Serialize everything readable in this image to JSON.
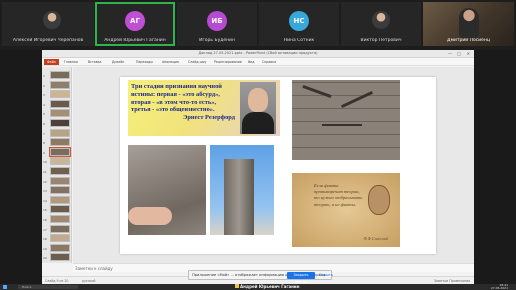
{
  "participants": [
    {
      "name": "Алексей Игоревич Черепанов",
      "initials": "",
      "color": "",
      "type": "photo"
    },
    {
      "name": "Андрей Юрьевич Гаганин",
      "initials": "АГ",
      "color": "#c14fd6",
      "type": "initials",
      "active": true
    },
    {
      "name": "Игорь Будёнин",
      "initials": "ИБ",
      "color": "#b64ad3",
      "type": "initials"
    },
    {
      "name": "Нина Сотник",
      "initials": "НС",
      "color": "#37a8d8",
      "type": "initials"
    },
    {
      "name": "Виктор Петрович",
      "initials": "",
      "color": "",
      "type": "photo"
    },
    {
      "name": "Дмитрий Лосиенц",
      "initials": "",
      "color": "",
      "type": "video"
    }
  ],
  "window": {
    "title": "Доклад 27.05.2021.pptx - PowerPoint (Сбой активации продукта)",
    "controls": [
      "—",
      "□",
      "✕"
    ]
  },
  "ribbon_tabs": [
    "Файл",
    "Главная",
    "Вставка",
    "Дизайн",
    "Переходы",
    "Анимация",
    "Слайд-шоу",
    "Рецензирование",
    "Вид",
    "Справка"
  ],
  "slide_thumbnails": [
    "1",
    "2",
    "3",
    "4",
    "5",
    "6",
    "7",
    "8",
    "9",
    "10",
    "11",
    "12",
    "13",
    "14",
    "15",
    "16",
    "17",
    "18",
    "19",
    "20"
  ],
  "slide": {
    "quote_lines": [
      "Три стадии признания научной",
      "истины: первая - «это абсурд»,",
      "вторая - «в этом что-то есть»,",
      "третья - «это общеизвестно».",
      "Эрнест Резерфорд"
    ],
    "parchment_lines": [
      "Если факты",
      "противоречат теории,",
      "то нужно отбрасывать",
      "теорию, а не факты."
    ],
    "parchment_signature": "Ф.Ф.Спасский"
  },
  "notes_placeholder": "Заметки к слайду",
  "status": {
    "left": "Слайд 9 из 20",
    "lang": "русский",
    "right": "Заметки  Примечания"
  },
  "share_banner": {
    "message": "Приложение «Мой» ... отображает информацию о трансляции экрана.",
    "stop_label": "Закрыть доступ",
    "hide_label": "Скрыть"
  },
  "taskbar": {
    "search_placeholder": "Поиск",
    "presenter": "Андрей Юрьевич Гаганин",
    "time": "18:41",
    "date": "27.05.2021"
  }
}
